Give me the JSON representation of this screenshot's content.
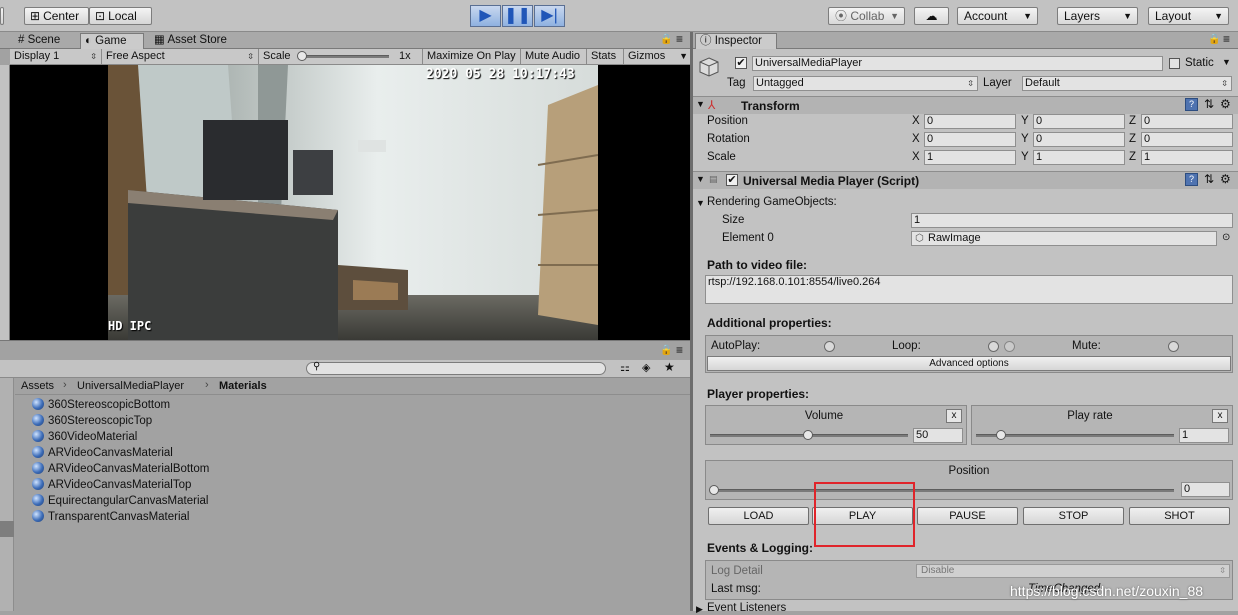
{
  "toolbar": {
    "center_label": "Center",
    "local_label": "Local",
    "collab_label": "Collab",
    "account_label": "Account",
    "layers_label": "Layers",
    "layout_label": "Layout",
    "icons": [
      "play-icon",
      "pause-icon",
      "step-icon",
      "cloud-icon"
    ],
    "play_color": "#2056b8"
  },
  "scene_tabs": {
    "scene": "Scene",
    "game": "Game",
    "asset_store": "Asset Store"
  },
  "game_bar": {
    "display": "Display 1",
    "aspect": "Free Aspect",
    "scale_label": "Scale",
    "scale_value": "1x",
    "maximize": "Maximize On Play",
    "mute": "Mute Audio",
    "stats": "Stats",
    "gizmos": "Gizmos"
  },
  "video": {
    "timestamp": "2020 05 28 10:17:43",
    "watermark": "HD IPC"
  },
  "project": {
    "breadcrumb": [
      "Assets",
      "UniversalMediaPlayer",
      "Materials"
    ],
    "materials": [
      "360StereoscopicBottom",
      "360StereoscopicTop",
      "360VideoMaterial",
      "ARVideoCanvasMaterial",
      "ARVideoCanvasMaterialBottom",
      "ARVideoCanvasMaterialTop",
      "EquirectangularCanvasMaterial",
      "TransparentCanvasMaterial"
    ]
  },
  "inspector": {
    "tab_label": "Inspector",
    "object_name": "UniversalMediaPlayer",
    "static_label": "Static",
    "tag_label": "Tag",
    "tag_value": "Untagged",
    "layer_label": "Layer",
    "layer_value": "Default",
    "transform": {
      "title": "Transform",
      "rows": [
        {
          "label": "Position",
          "x": "0",
          "y": "0",
          "z": "0"
        },
        {
          "label": "Rotation",
          "x": "0",
          "y": "0",
          "z": "0"
        },
        {
          "label": "Scale",
          "x": "1",
          "y": "1",
          "z": "1"
        }
      ],
      "axis_x": "X",
      "axis_y": "Y",
      "axis_z": "Z"
    },
    "script": {
      "title": "Universal Media Player (Script)",
      "rendering_label": "Rendering GameObjects:",
      "size_label": "Size",
      "size_value": "1",
      "element_label": "Element 0",
      "element_value": "RawImage",
      "path_label": "Path to video file:",
      "path_value": "rtsp://192.168.0.101:8554/live0.264",
      "additional_label": "Additional properties:",
      "autoplay_label": "AutoPlay:",
      "loop_label": "Loop:",
      "mute_label": "Mute:",
      "advanced_label": "Advanced options",
      "player_label": "Player properties:",
      "volume_label": "Volume",
      "volume_value": "50",
      "volume_fraction": 0.5,
      "playrate_label": "Play rate",
      "playrate_value": "1",
      "position_label": "Position",
      "position_value": "0",
      "buttons": [
        "LOAD",
        "PLAY",
        "PAUSE",
        "STOP",
        "SHOT"
      ],
      "events_label": "Events & Logging:",
      "log_detail_label": "Log Detail",
      "log_detail_value": "Disable",
      "last_msg_label": "Last msg:",
      "last_msg_value": "TimeChanged",
      "event_listeners_label": "Event Listeners"
    },
    "highlight_color": "#e0242a"
  },
  "watermark": "https://blog.csdn.net/zouxin_88"
}
